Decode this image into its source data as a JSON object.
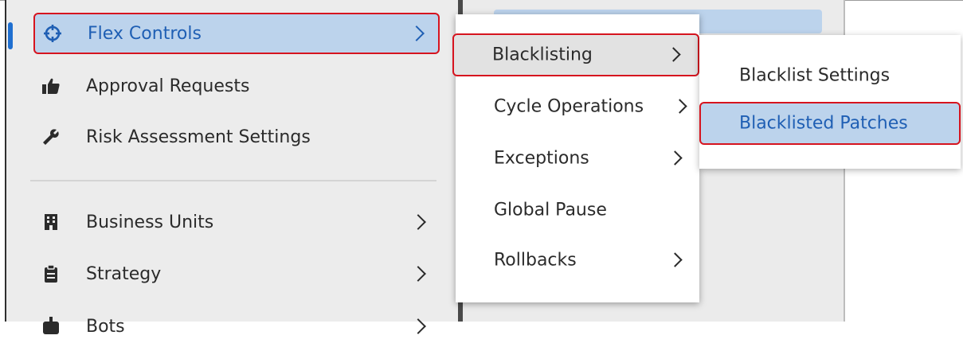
{
  "sidebar": {
    "items": [
      {
        "label": "Flex Controls",
        "icon": "crosshair-icon",
        "has_submenu": true,
        "active": true
      },
      {
        "label": "Approval Requests",
        "icon": "thumbs-up-icon",
        "has_submenu": false
      },
      {
        "label": "Risk Assessment Settings",
        "icon": "wrench-icon",
        "has_submenu": false
      },
      {
        "label": "Business Units",
        "icon": "building-icon",
        "has_submenu": true
      },
      {
        "label": "Strategy",
        "icon": "clipboard-icon",
        "has_submenu": true
      },
      {
        "label": "Bots",
        "icon": "bot-icon",
        "has_submenu": true
      }
    ]
  },
  "flex_submenu": {
    "items": [
      {
        "label": "Blacklisting",
        "has_submenu": true,
        "highlighted": true
      },
      {
        "label": "Cycle Operations",
        "has_submenu": true
      },
      {
        "label": "Exceptions",
        "has_submenu": true
      },
      {
        "label": "Global Pause",
        "has_submenu": false
      },
      {
        "label": "Rollbacks",
        "has_submenu": true
      }
    ]
  },
  "blacklisting_submenu": {
    "items": [
      {
        "label": "Blacklist Settings",
        "selected": false
      },
      {
        "label": "Blacklisted Patches",
        "selected": true
      }
    ]
  },
  "colors": {
    "accent_blue": "#1f5fb4",
    "highlight_bg": "#bcd3ec",
    "annotation_red": "#d6141f"
  }
}
